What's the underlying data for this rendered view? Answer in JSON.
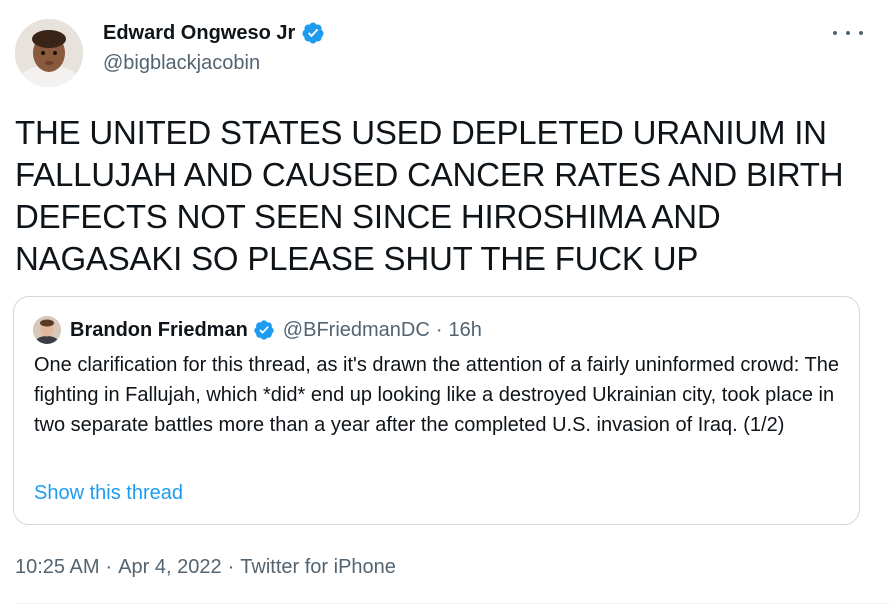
{
  "tweet": {
    "author": {
      "name": "Edward Ongweso Jr",
      "handle": "@bigblackjacobin",
      "verified": true
    },
    "more_icon": "more-horizontal-icon",
    "text": "THE UNITED STATES USED DEPLETED URANIUM IN FALLUJAH AND CAUSED CANCER RATES AND BIRTH DEFECTS NOT SEEN SINCE HIROSHIMA AND NAGASAKI SO PLEASE SHUT THE FUCK UP",
    "footer": {
      "time": "10:25 AM",
      "separator": "·",
      "date": "Apr 4, 2022",
      "source": "Twitter for iPhone"
    }
  },
  "quote": {
    "author": {
      "name": "Brandon Friedman",
      "handle": "@BFriedmanDC",
      "verified": true
    },
    "separator": "·",
    "time": "16h",
    "text": "One clarification for this thread, as it's drawn the attention of a fairly uninformed crowd: The fighting in Fallujah, which *did* end up looking like a destroyed Ukrainian city, took place in two separate battles more than a year after the completed U.S. invasion of Iraq. (1/2)",
    "show_thread": "Show this thread"
  },
  "colors": {
    "text": "#0f1419",
    "secondary": "#536471",
    "link": "#1d9bf0",
    "verified": "#1d9bf0",
    "border": "#cfd9de"
  }
}
